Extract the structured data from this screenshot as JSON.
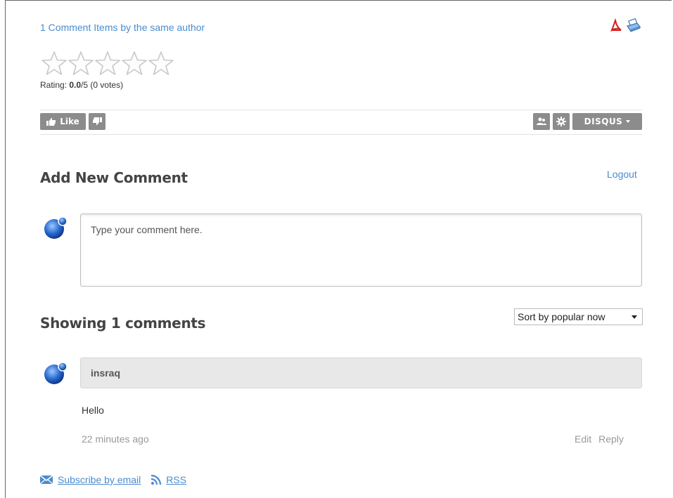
{
  "top": {
    "comment_link": "1 Comment",
    "author_link": "Items by the same author"
  },
  "doc_icons": {
    "pdf": "pdf-icon",
    "print": "print-icon"
  },
  "rating": {
    "label": "Rating: ",
    "score": "0.0",
    "suffix": "/5 (0 votes)",
    "stars_filled": 0,
    "stars_total": 5
  },
  "toolbar": {
    "like_label": "Like",
    "disqus_label": "DISQUS",
    "dislike_icon": "thumbs-down-icon",
    "community_icon": "people-icon",
    "settings_icon": "gear-icon"
  },
  "add_comment": {
    "title": "Add New Comment",
    "logout": "Logout",
    "placeholder": "Type your comment here."
  },
  "comments": {
    "title": "Showing 1 comments",
    "sort_selected": "Sort by popular now",
    "items": [
      {
        "author": "insraq",
        "text": "Hello",
        "time": "22 minutes ago",
        "edit": "Edit",
        "reply": "Reply"
      }
    ]
  },
  "footer": {
    "subscribe": "Subscribe by email",
    "rss": "RSS"
  },
  "colors": {
    "link": "#4a8ccf",
    "button_gray": "#8c8c8c",
    "author_bar": "#e8e8e8"
  }
}
